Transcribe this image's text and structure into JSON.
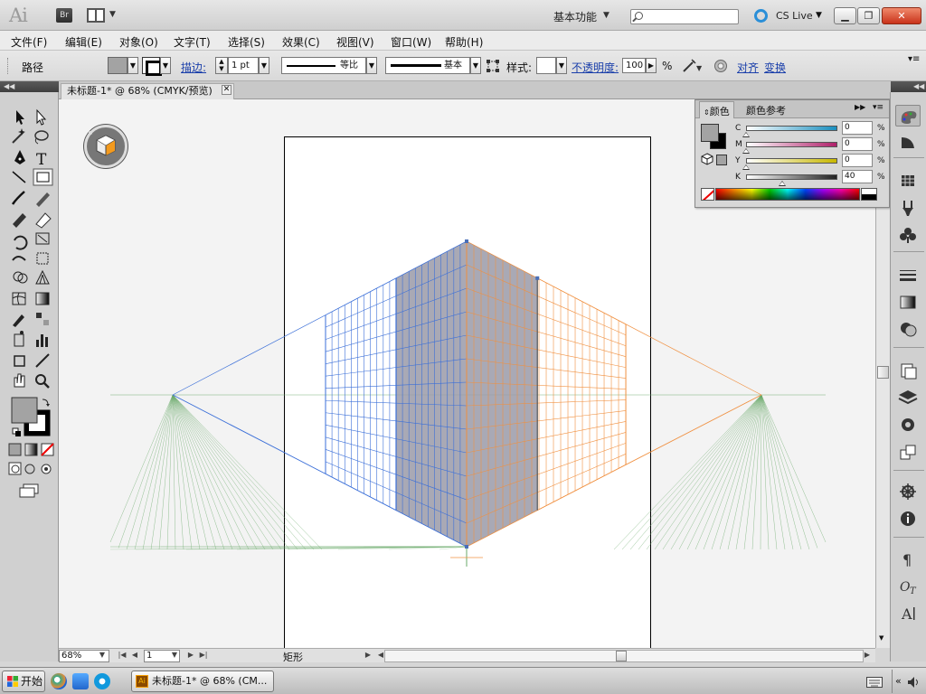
{
  "title_bar": {
    "app_logo": "Ai",
    "bridge_label": "Br",
    "workspace": "基本功能",
    "search_placeholder": "",
    "cs_live": "CS Live",
    "icons": [
      "arrange-documents-icon",
      "search-icon",
      "cs-live-icon",
      "minimize-icon",
      "maximize-icon",
      "close-icon"
    ]
  },
  "menu": {
    "items": [
      "文件(F)",
      "编辑(E)",
      "对象(O)",
      "文字(T)",
      "选择(S)",
      "效果(C)",
      "视图(V)",
      "窗口(W)",
      "帮助(H)"
    ]
  },
  "control_bar": {
    "selection_type": "路径",
    "stroke_label": "描边:",
    "stroke_weight": "1 pt",
    "stroke_profile": "等比",
    "brush": "基本",
    "style_label": "样式:",
    "opacity_label": "不透明度:",
    "opacity_value": "100",
    "opacity_unit": "%",
    "align_link": "对齐",
    "transform_link": "变换",
    "fill_color": "#a3a3a3"
  },
  "document": {
    "tab_title": "未标题-1* @ 68% (CMYK/预览)",
    "zoom": "68%",
    "page": "1",
    "status_tool": "矩形"
  },
  "color_panel": {
    "tabs": [
      "颜色",
      "颜色参考"
    ],
    "channels": [
      {
        "label": "C",
        "value": "0",
        "unit": "%"
      },
      {
        "label": "M",
        "value": "0",
        "unit": "%"
      },
      {
        "label": "Y",
        "value": "0",
        "unit": "%"
      },
      {
        "label": "K",
        "value": "40",
        "unit": "%"
      }
    ],
    "colors": {
      "cyan": "#1a8fbf",
      "magenta": "#b0206a",
      "yellow": "#c8b800",
      "black": "#222222",
      "fill": "#a3a3a3"
    }
  },
  "perspective": {
    "left_grid_color": "#3b6fd8",
    "right_grid_color": "#f09040",
    "ground_grid_color": "#6aaa6a",
    "plane_fill": "#9a9aa8"
  },
  "taskbar": {
    "start": "开始",
    "task_title": "未标题-1* @ 68% (CM..."
  }
}
